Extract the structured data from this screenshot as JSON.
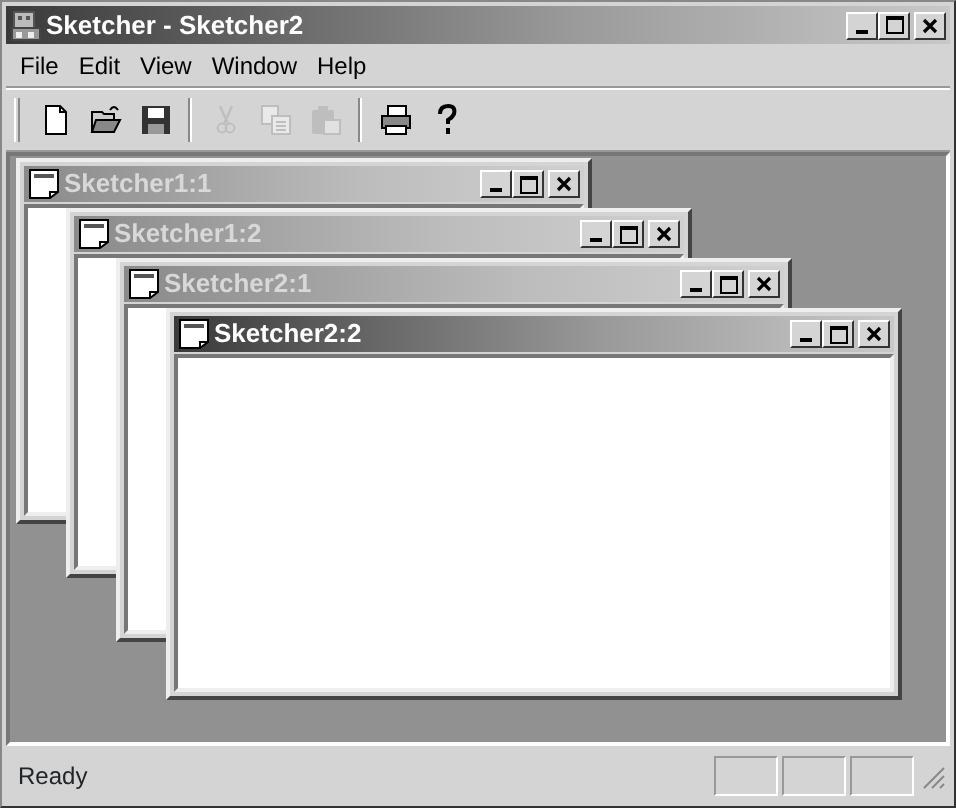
{
  "window": {
    "title": "Sketcher - Sketcher2"
  },
  "menu": [
    "File",
    "Edit",
    "View",
    "Window",
    "Help"
  ],
  "toolbar": [
    {
      "kind": "new",
      "disabled": false
    },
    {
      "kind": "open",
      "disabled": false
    },
    {
      "kind": "save",
      "disabled": false
    },
    {
      "kind": "separator"
    },
    {
      "kind": "cut",
      "disabled": true
    },
    {
      "kind": "copy",
      "disabled": true
    },
    {
      "kind": "paste",
      "disabled": true
    },
    {
      "kind": "separator"
    },
    {
      "kind": "print",
      "disabled": false
    },
    {
      "kind": "help",
      "disabled": false
    }
  ],
  "child_windows": [
    {
      "title": "Sketcher1:1",
      "active": false
    },
    {
      "title": "Sketcher1:2",
      "active": false
    },
    {
      "title": "Sketcher2:1",
      "active": false
    },
    {
      "title": "Sketcher2:2",
      "active": true
    }
  ],
  "status_bar": {
    "text": "Ready"
  }
}
